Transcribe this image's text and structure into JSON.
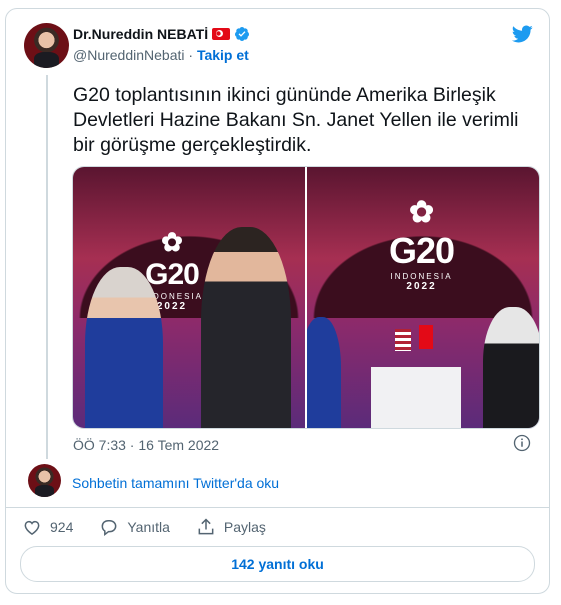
{
  "author": {
    "name": "Dr.Nureddin NEBATİ",
    "handle": "@NureddinNebati",
    "separator": "·",
    "follow_label": "Takip et"
  },
  "tweet": {
    "text": "G20 toplantısının ikinci gününde Amerika Birleşik Devletleri Hazine Bakanı Sn. Janet Yellen ile verimli bir görüşme gerçekleştirdik.",
    "timestamp": "ÖÖ 7:33 · 16 Tem 2022"
  },
  "media": {
    "photo1": {
      "logo": "G20",
      "sub": "INDONESIA",
      "year": "2022"
    },
    "photo2": {
      "logo": "G20",
      "sub": "INDONESIA",
      "year": "2022"
    }
  },
  "conversation_link": "Sohbetin tamamını Twitter'da oku",
  "actions": {
    "like_count": "924",
    "reply_label": "Yanıtla",
    "share_label": "Paylaş"
  },
  "replies_button": "142 yanıtı oku",
  "colors": {
    "accent": "#1d9bf0",
    "link": "#006fd6",
    "border": "#cfd9de",
    "muted": "#536471"
  }
}
